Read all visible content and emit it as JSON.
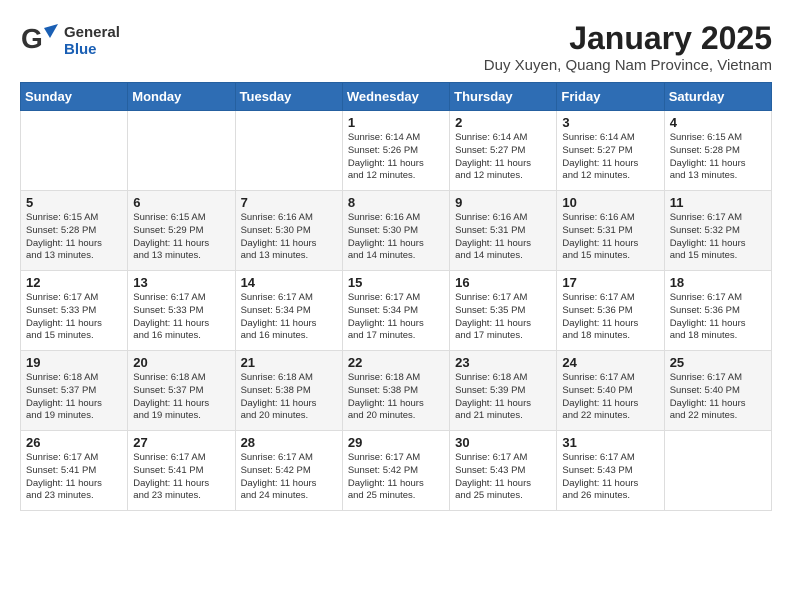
{
  "header": {
    "logo_general": "General",
    "logo_blue": "Blue",
    "month_title": "January 2025",
    "location": "Duy Xuyen, Quang Nam Province, Vietnam"
  },
  "days_of_week": [
    "Sunday",
    "Monday",
    "Tuesday",
    "Wednesday",
    "Thursday",
    "Friday",
    "Saturday"
  ],
  "weeks": [
    [
      {
        "day": "",
        "info": ""
      },
      {
        "day": "",
        "info": ""
      },
      {
        "day": "",
        "info": ""
      },
      {
        "day": "1",
        "info": "Sunrise: 6:14 AM\nSunset: 5:26 PM\nDaylight: 11 hours\nand 12 minutes."
      },
      {
        "day": "2",
        "info": "Sunrise: 6:14 AM\nSunset: 5:27 PM\nDaylight: 11 hours\nand 12 minutes."
      },
      {
        "day": "3",
        "info": "Sunrise: 6:14 AM\nSunset: 5:27 PM\nDaylight: 11 hours\nand 12 minutes."
      },
      {
        "day": "4",
        "info": "Sunrise: 6:15 AM\nSunset: 5:28 PM\nDaylight: 11 hours\nand 13 minutes."
      }
    ],
    [
      {
        "day": "5",
        "info": "Sunrise: 6:15 AM\nSunset: 5:28 PM\nDaylight: 11 hours\nand 13 minutes."
      },
      {
        "day": "6",
        "info": "Sunrise: 6:15 AM\nSunset: 5:29 PM\nDaylight: 11 hours\nand 13 minutes."
      },
      {
        "day": "7",
        "info": "Sunrise: 6:16 AM\nSunset: 5:30 PM\nDaylight: 11 hours\nand 13 minutes."
      },
      {
        "day": "8",
        "info": "Sunrise: 6:16 AM\nSunset: 5:30 PM\nDaylight: 11 hours\nand 14 minutes."
      },
      {
        "day": "9",
        "info": "Sunrise: 6:16 AM\nSunset: 5:31 PM\nDaylight: 11 hours\nand 14 minutes."
      },
      {
        "day": "10",
        "info": "Sunrise: 6:16 AM\nSunset: 5:31 PM\nDaylight: 11 hours\nand 15 minutes."
      },
      {
        "day": "11",
        "info": "Sunrise: 6:17 AM\nSunset: 5:32 PM\nDaylight: 11 hours\nand 15 minutes."
      }
    ],
    [
      {
        "day": "12",
        "info": "Sunrise: 6:17 AM\nSunset: 5:33 PM\nDaylight: 11 hours\nand 15 minutes."
      },
      {
        "day": "13",
        "info": "Sunrise: 6:17 AM\nSunset: 5:33 PM\nDaylight: 11 hours\nand 16 minutes."
      },
      {
        "day": "14",
        "info": "Sunrise: 6:17 AM\nSunset: 5:34 PM\nDaylight: 11 hours\nand 16 minutes."
      },
      {
        "day": "15",
        "info": "Sunrise: 6:17 AM\nSunset: 5:34 PM\nDaylight: 11 hours\nand 17 minutes."
      },
      {
        "day": "16",
        "info": "Sunrise: 6:17 AM\nSunset: 5:35 PM\nDaylight: 11 hours\nand 17 minutes."
      },
      {
        "day": "17",
        "info": "Sunrise: 6:17 AM\nSunset: 5:36 PM\nDaylight: 11 hours\nand 18 minutes."
      },
      {
        "day": "18",
        "info": "Sunrise: 6:17 AM\nSunset: 5:36 PM\nDaylight: 11 hours\nand 18 minutes."
      }
    ],
    [
      {
        "day": "19",
        "info": "Sunrise: 6:18 AM\nSunset: 5:37 PM\nDaylight: 11 hours\nand 19 minutes."
      },
      {
        "day": "20",
        "info": "Sunrise: 6:18 AM\nSunset: 5:37 PM\nDaylight: 11 hours\nand 19 minutes."
      },
      {
        "day": "21",
        "info": "Sunrise: 6:18 AM\nSunset: 5:38 PM\nDaylight: 11 hours\nand 20 minutes."
      },
      {
        "day": "22",
        "info": "Sunrise: 6:18 AM\nSunset: 5:38 PM\nDaylight: 11 hours\nand 20 minutes."
      },
      {
        "day": "23",
        "info": "Sunrise: 6:18 AM\nSunset: 5:39 PM\nDaylight: 11 hours\nand 21 minutes."
      },
      {
        "day": "24",
        "info": "Sunrise: 6:17 AM\nSunset: 5:40 PM\nDaylight: 11 hours\nand 22 minutes."
      },
      {
        "day": "25",
        "info": "Sunrise: 6:17 AM\nSunset: 5:40 PM\nDaylight: 11 hours\nand 22 minutes."
      }
    ],
    [
      {
        "day": "26",
        "info": "Sunrise: 6:17 AM\nSunset: 5:41 PM\nDaylight: 11 hours\nand 23 minutes."
      },
      {
        "day": "27",
        "info": "Sunrise: 6:17 AM\nSunset: 5:41 PM\nDaylight: 11 hours\nand 23 minutes."
      },
      {
        "day": "28",
        "info": "Sunrise: 6:17 AM\nSunset: 5:42 PM\nDaylight: 11 hours\nand 24 minutes."
      },
      {
        "day": "29",
        "info": "Sunrise: 6:17 AM\nSunset: 5:42 PM\nDaylight: 11 hours\nand 25 minutes."
      },
      {
        "day": "30",
        "info": "Sunrise: 6:17 AM\nSunset: 5:43 PM\nDaylight: 11 hours\nand 25 minutes."
      },
      {
        "day": "31",
        "info": "Sunrise: 6:17 AM\nSunset: 5:43 PM\nDaylight: 11 hours\nand 26 minutes."
      },
      {
        "day": "",
        "info": ""
      }
    ]
  ]
}
